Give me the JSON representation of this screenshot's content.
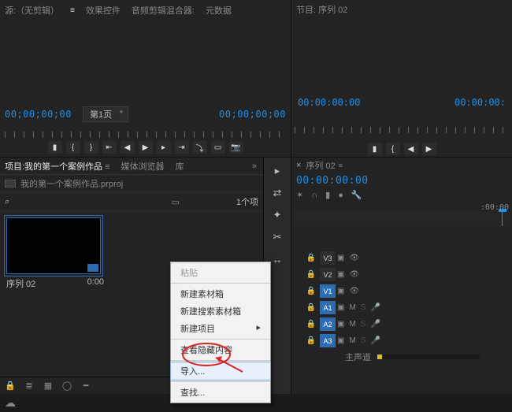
{
  "source": {
    "tabs": [
      "源:（无剪辑）",
      "效果控件",
      "音频剪辑混合器:",
      "元数据"
    ],
    "tc_in": "00;00;00;00",
    "tc_out": "00;00;00;00",
    "page_label": "第1页"
  },
  "program": {
    "title": "节目: 序列 02",
    "tc_in": "00:00:00:00",
    "tc_out": "00:00:00:"
  },
  "project": {
    "tabs": {
      "active": "项目:我的第一个案例作品",
      "others": [
        "媒体浏览器",
        "库"
      ]
    },
    "file": "我的第一个案例作品.prproj",
    "item_count": "1个项",
    "clip": {
      "name": "序列 02",
      "duration": "0:00"
    }
  },
  "context_menu": {
    "items": [
      {
        "label": "粘贴",
        "enabled": false
      },
      {
        "sep": true
      },
      {
        "label": "新建素材箱",
        "enabled": true
      },
      {
        "label": "新建搜索素材箱",
        "enabled": true
      },
      {
        "label": "新建项目",
        "enabled": true,
        "submenu": true
      },
      {
        "sep": true
      },
      {
        "label": "查看隐藏内容",
        "enabled": true
      },
      {
        "sep": true
      },
      {
        "label": "导入...",
        "enabled": true,
        "highlight": true
      },
      {
        "sep": true
      },
      {
        "label": "查找...",
        "enabled": true
      }
    ]
  },
  "timeline": {
    "tab": "序列 02",
    "tc": "00:00:00:00",
    "time_label": ":00:00",
    "tracks": {
      "video": [
        {
          "tag": "V3",
          "on": false
        },
        {
          "tag": "V2",
          "on": false
        },
        {
          "tag": "V1",
          "on": true
        }
      ],
      "audio": [
        {
          "tag": "A1",
          "on": true
        },
        {
          "tag": "A2",
          "on": true
        },
        {
          "tag": "A3",
          "on": true
        }
      ],
      "master": "主声道"
    }
  }
}
